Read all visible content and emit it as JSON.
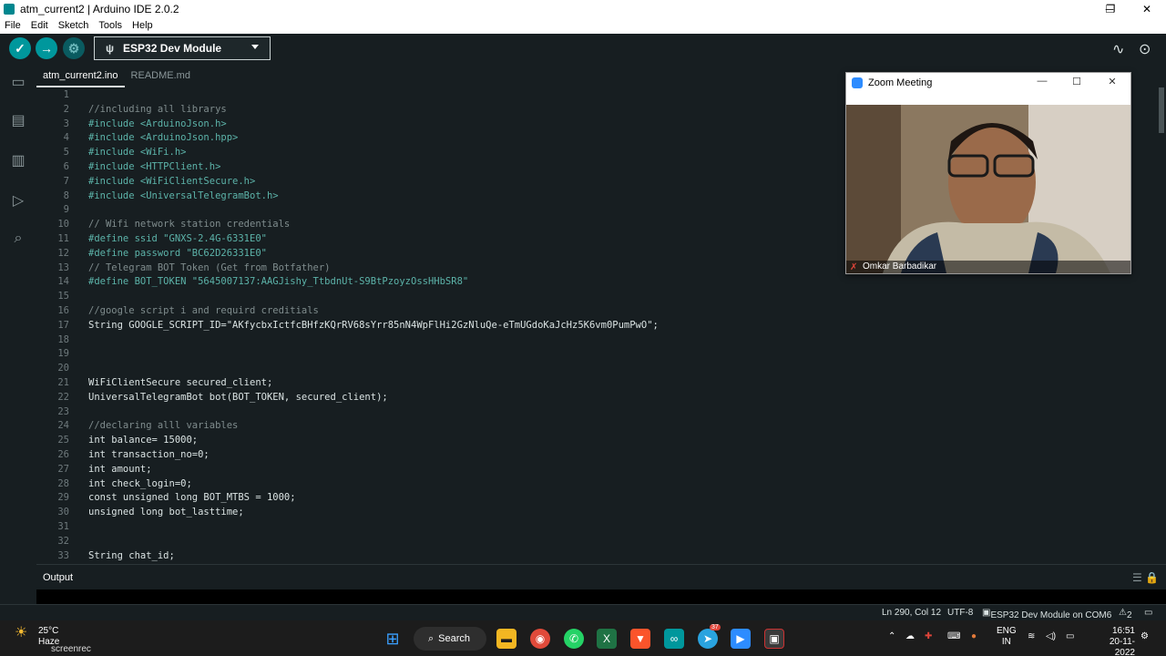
{
  "window": {
    "title": "atm_current2 | Arduino IDE 2.0.2",
    "controls": [
      "─",
      "❐",
      "✕"
    ]
  },
  "menu": [
    "File",
    "Edit",
    "Sketch",
    "Tools",
    "Help"
  ],
  "toolbar": {
    "board": "ESP32 Dev Module",
    "verify_icon": "check-icon",
    "upload_icon": "arrow-right-icon",
    "debug_icon": "debug-icon"
  },
  "tabs": [
    "atm_current2.ino",
    "README.md"
  ],
  "code": [
    {
      "n": "1",
      "t": "",
      "c": "plain"
    },
    {
      "n": "2",
      "t": "//including all librarys",
      "c": "cmt"
    },
    {
      "n": "3",
      "t": "#include <ArduinoJson.h>",
      "c": "pre"
    },
    {
      "n": "4",
      "t": "#include <ArduinoJson.hpp>",
      "c": "pre"
    },
    {
      "n": "5",
      "t": "#include <WiFi.h>",
      "c": "pre"
    },
    {
      "n": "6",
      "t": "#include <HTTPClient.h>",
      "c": "pre"
    },
    {
      "n": "7",
      "t": "#include <WiFiClientSecure.h>",
      "c": "pre"
    },
    {
      "n": "8",
      "t": "#include <UniversalTelegramBot.h>",
      "c": "pre"
    },
    {
      "n": "9",
      "t": "",
      "c": "plain"
    },
    {
      "n": "10",
      "t": "// Wifi network station credentials",
      "c": "cmt"
    },
    {
      "n": "11",
      "t": "#define ssid \"GNXS-2.4G-6331E0\"",
      "c": "pre"
    },
    {
      "n": "12",
      "t": "#define password \"BC62D26331E0\"",
      "c": "pre"
    },
    {
      "n": "13",
      "t": "// Telegram BOT Token (Get from Botfather)",
      "c": "cmt"
    },
    {
      "n": "14",
      "t": "#define BOT_TOKEN \"5645007137:AAGJishy_TtbdnUt-S9BtPzoyzOssHHbSR8\"",
      "c": "pre"
    },
    {
      "n": "15",
      "t": "",
      "c": "plain"
    },
    {
      "n": "16",
      "t": "//google script i and requird creditials",
      "c": "cmt"
    },
    {
      "n": "17",
      "t": "String GOOGLE_SCRIPT_ID=\"AKfycbxIctfcBHfzKQrRV68sYrr85nN4WpFlHi2GzNluQe-eTmUGdoKaJcHz5K6vm0PumPwO\";",
      "c": "plain"
    },
    {
      "n": "18",
      "t": "",
      "c": "plain"
    },
    {
      "n": "19",
      "t": "",
      "c": "plain"
    },
    {
      "n": "20",
      "t": "",
      "c": "plain"
    },
    {
      "n": "21",
      "t": "WiFiClientSecure secured_client;",
      "c": "plain"
    },
    {
      "n": "22",
      "t": "UniversalTelegramBot bot(BOT_TOKEN, secured_client);",
      "c": "plain"
    },
    {
      "n": "23",
      "t": "",
      "c": "plain"
    },
    {
      "n": "24",
      "t": "//declaring alll variables",
      "c": "cmt"
    },
    {
      "n": "25",
      "t": "int balance= 15000;",
      "c": "plain"
    },
    {
      "n": "26",
      "t": "int transaction_no=0;",
      "c": "plain"
    },
    {
      "n": "27",
      "t": "int amount;",
      "c": "plain"
    },
    {
      "n": "28",
      "t": "int check_login=0;",
      "c": "plain"
    },
    {
      "n": "29",
      "t": "const unsigned long BOT_MTBS = 1000;",
      "c": "plain"
    },
    {
      "n": "30",
      "t": "unsigned long bot_lasttime;",
      "c": "plain"
    },
    {
      "n": "31",
      "t": "",
      "c": "plain"
    },
    {
      "n": "32",
      "t": "",
      "c": "plain"
    },
    {
      "n": "33",
      "t": "String chat_id;",
      "c": "plain"
    }
  ],
  "output": {
    "title": "Output"
  },
  "status": {
    "position": "Ln 290, Col 12",
    "encoding": "UTF-8",
    "board_port": "ESP32 Dev Module on COM6",
    "notifications": "2"
  },
  "zoom": {
    "title": "Zoom Meeting",
    "participant": "Omkar Barbadikar"
  },
  "taskbar": {
    "temperature": "25°C",
    "weather": "Haze",
    "search": "Search",
    "lang1": "ENG",
    "lang2": "IN",
    "time": "16:51",
    "date": "20-11-2022",
    "watermark": "screenrec",
    "telegram_badge": "37"
  }
}
